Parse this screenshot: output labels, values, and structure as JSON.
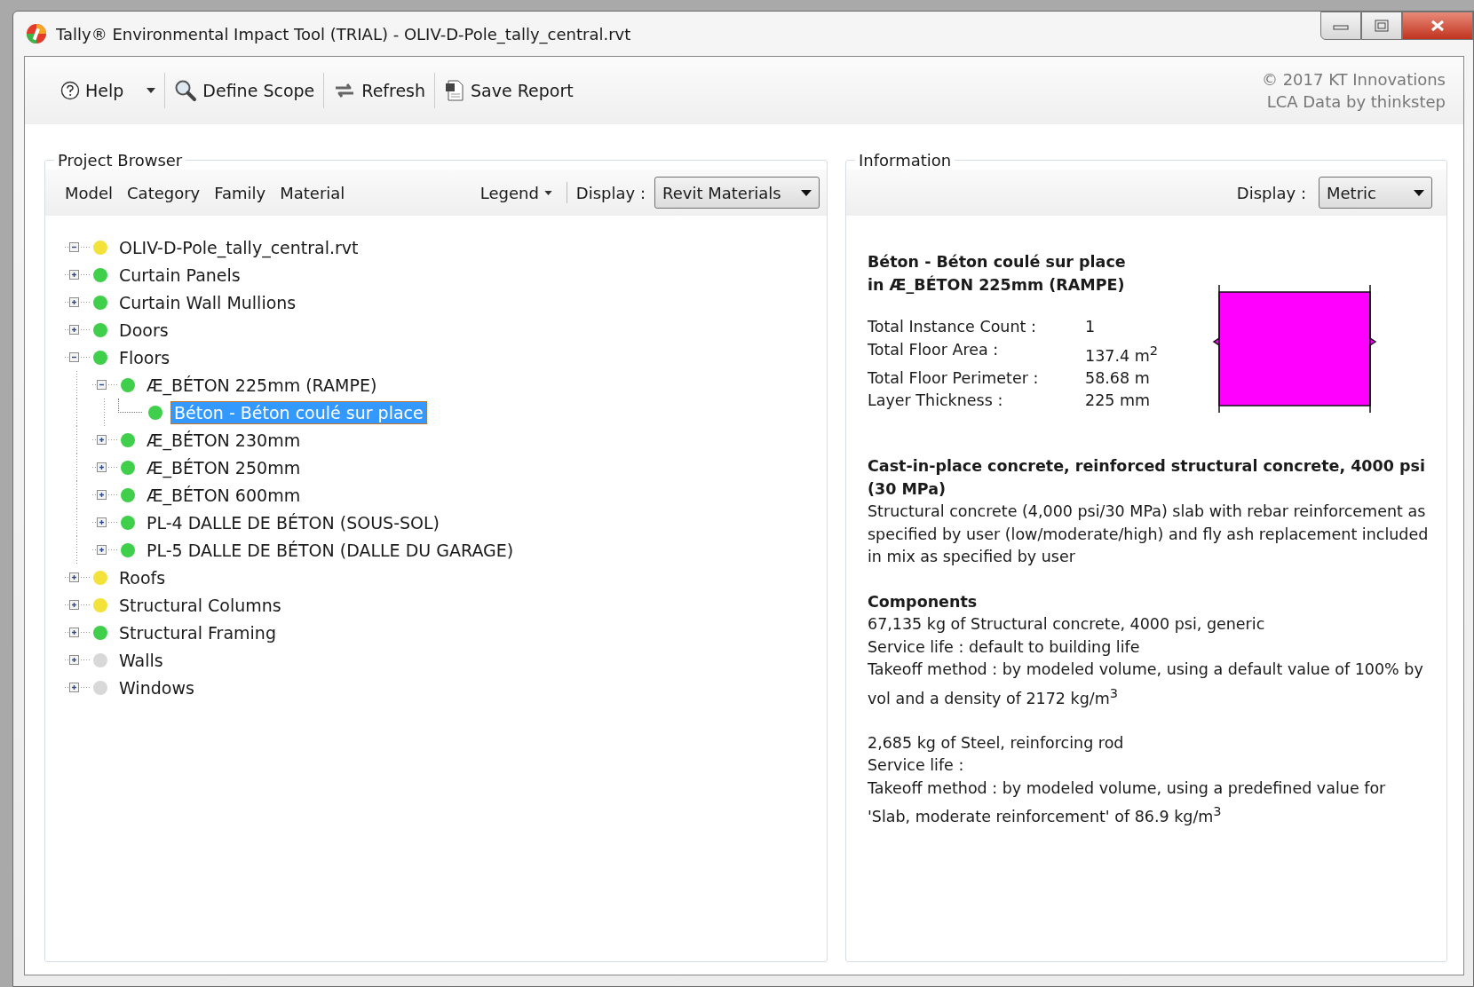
{
  "window": {
    "title": "Tally® Environmental Impact Tool (TRIAL) - OLIV-D-Pole_tally_central.rvt"
  },
  "toolbar": {
    "buttons": [
      {
        "label": "Help",
        "kind": "help"
      },
      {
        "label": "Define Scope",
        "kind": "scope"
      },
      {
        "label": "Refresh",
        "kind": "refresh"
      },
      {
        "label": "Save Report",
        "kind": "save"
      }
    ],
    "credits": [
      "© 2017 KT Innovations",
      "LCA Data by thinkstep"
    ]
  },
  "project_browser": {
    "title": "Project Browser",
    "views": [
      "Model",
      "Category",
      "Family",
      "Material"
    ],
    "legend": "Legend",
    "display_label": "Display :",
    "display_value": "Revit Materials",
    "tree": {
      "label": "OLIV-D-Pole_tally_central.rvt",
      "color": "#f2e23a",
      "kind": "folder",
      "expanded": true,
      "selected": false,
      "children": [
        {
          "label": "Curtain Panels",
          "color": "#3fcf4a",
          "kind": "folder",
          "expanded": false,
          "selected": false
        },
        {
          "label": "Curtain Wall Mullions",
          "color": "#3fcf4a",
          "kind": "folder",
          "expanded": false,
          "selected": false
        },
        {
          "label": "Doors",
          "color": "#3fcf4a",
          "kind": "folder",
          "expanded": false,
          "selected": false
        },
        {
          "label": "Floors",
          "color": "#3fcf4a",
          "kind": "folder",
          "expanded": true,
          "selected": false,
          "children": [
            {
              "label": "Æ_BÉTON 225mm (RAMPE)",
              "color": "#3fcf4a",
              "kind": "folder",
              "expanded": true,
              "selected": false,
              "children": [
                {
                  "label": "Béton - Béton coulé sur place",
                  "color": "#3fcf4a",
                  "kind": "leaf",
                  "selected": true
                }
              ]
            },
            {
              "label": "Æ_BÉTON 230mm",
              "color": "#3fcf4a",
              "kind": "folder",
              "expanded": false,
              "selected": false
            },
            {
              "label": "Æ_BÉTON 250mm",
              "color": "#3fcf4a",
              "kind": "folder",
              "expanded": false,
              "selected": false
            },
            {
              "label": "Æ_BÉTON 600mm",
              "color": "#3fcf4a",
              "kind": "folder",
              "expanded": false,
              "selected": false
            },
            {
              "label": "PL-4 DALLE DE BÉTON (SOUS-SOL)",
              "color": "#3fcf4a",
              "kind": "folder",
              "expanded": false,
              "selected": false
            },
            {
              "label": "PL-5 DALLE DE BÉTON (DALLE DU GARAGE)",
              "color": "#3fcf4a",
              "kind": "folder",
              "expanded": false,
              "selected": false
            }
          ]
        },
        {
          "label": "Roofs",
          "color": "#f2e23a",
          "kind": "folder",
          "expanded": false,
          "selected": false
        },
        {
          "label": "Structural Columns",
          "color": "#f2e23a",
          "kind": "folder",
          "expanded": false,
          "selected": false
        },
        {
          "label": "Structural Framing",
          "color": "#3fcf4a",
          "kind": "folder",
          "expanded": false,
          "selected": false
        },
        {
          "label": "Walls",
          "color": "#d8d8d8",
          "kind": "folder",
          "expanded": false,
          "selected": false
        },
        {
          "label": "Windows",
          "color": "#d8d8d8",
          "kind": "folder",
          "expanded": false,
          "selected": false
        }
      ]
    }
  },
  "information": {
    "title": "Information",
    "display_label": "Display :",
    "display_value": "Metric",
    "heading": [
      "Béton - Béton coulé sur place",
      "in Æ_BÉTON 225mm (RAMPE)"
    ],
    "properties": [
      {
        "label": "Total Instance Count :",
        "value": "1"
      },
      {
        "label": "Total Floor Area :",
        "value": "137.4 m$^{2}$"
      },
      {
        "label": "Total Floor Perimeter :",
        "value": "58.68 m"
      },
      {
        "label": "Layer Thickness :",
        "value": "225 mm"
      }
    ],
    "material_title": "Cast-in-place concrete, reinforced structural concrete, 4000 psi (30 MPa)",
    "material_description": "Structural concrete (4,000 psi/30 MPa) slab with rebar reinforcement as specified by user (low/moderate/high) and fly ash replacement included in mix as specified by user",
    "components_title": "Components",
    "components": [
      [
        "67,135 kg of Structural concrete, 4000 psi, generic",
        "Service life : default to building life",
        "Takeoff method : by modeled volume, using a default value of 100% by vol and a density of 2172 kg/m$^{3}$"
      ],
      [
        "2,685 kg of Steel, reinforcing rod",
        "Service life :",
        "Takeoff method : by modeled volume, using a predefined value for 'Slab, moderate reinforcement' of 86.9 kg/m$^{3}$"
      ]
    ]
  }
}
